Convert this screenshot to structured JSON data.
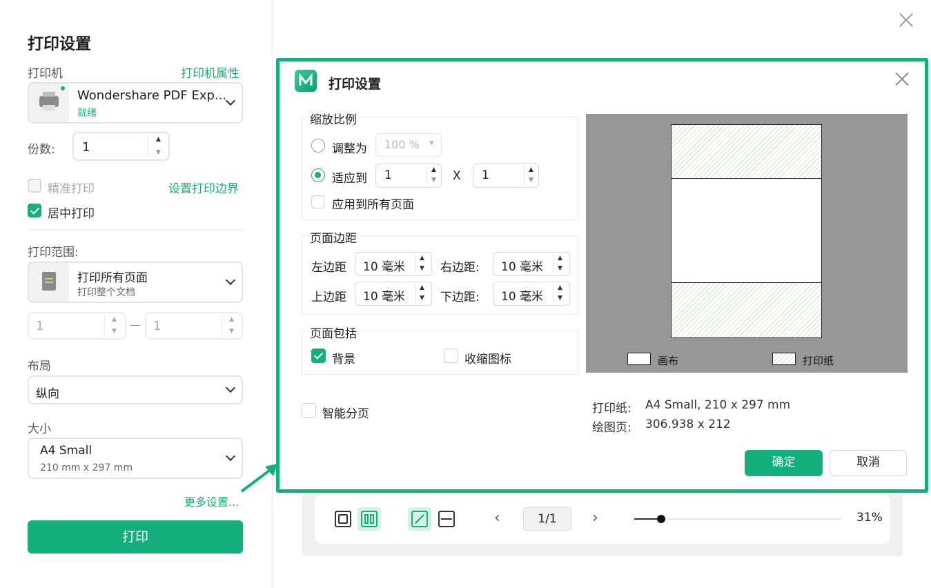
{
  "left_panel": {
    "title": "打印设置",
    "printer_label": "打印机",
    "printer_props_link": "打印机属性",
    "printer_name": "Wondershare PDF Exp...",
    "printer_status": "就绪",
    "copies_label": "份数:",
    "copies_value": "1",
    "precise_print_label": "精准打印",
    "set_margin_link": "设置打印边界",
    "center_print_label": "居中打印",
    "range_label": "打印范围:",
    "range_title": "打印所有页面",
    "range_sub": "打印整个文档",
    "range_from": "1",
    "range_dash": "—",
    "range_to": "1",
    "layout_label": "布局",
    "layout_value": "纵向",
    "size_label": "大小",
    "size_title": "A4 Small",
    "size_sub": "210 mm x 297 mm",
    "more_settings_link": "更多设置...",
    "print_button": "打印"
  },
  "preview_toolbar": {
    "page_indicator": "1/1",
    "zoom": "31%",
    "zoom_level": 0.31
  },
  "dialog": {
    "title": "打印设置",
    "scale_group": "缩放比例",
    "adjust_to_label": "调整为",
    "adjust_to_value": "100 %",
    "fit_to_label": "适应到",
    "fit_w": "1",
    "fit_x": "X",
    "fit_h": "1",
    "apply_all_label": "应用到所有页面",
    "margin_group": "页面边距",
    "left_margin_label": "左边距",
    "left_margin_value": "10 毫米",
    "right_margin_label": "右边距:",
    "right_margin_value": "10 毫米",
    "top_margin_label": "上边距",
    "top_margin_value": "10 毫米",
    "bottom_margin_label": "下边距:",
    "bottom_margin_value": "10 毫米",
    "include_group": "页面包括",
    "background_label": "背景",
    "collapse_icon_label": "收缩图标",
    "smart_paging_label": "智能分页",
    "legend_canvas": "画布",
    "legend_paper": "打印纸",
    "paper_info_label": "打印纸:",
    "paper_info_value": "A4 Small, 210 x 297 mm",
    "drawing_info_label": "绘图页:",
    "drawing_info_value": "306.938 x 212",
    "ok_button": "确定",
    "cancel_button": "取消"
  },
  "colors": {
    "accent": "#13b07d",
    "preview_bg": "#979797"
  }
}
